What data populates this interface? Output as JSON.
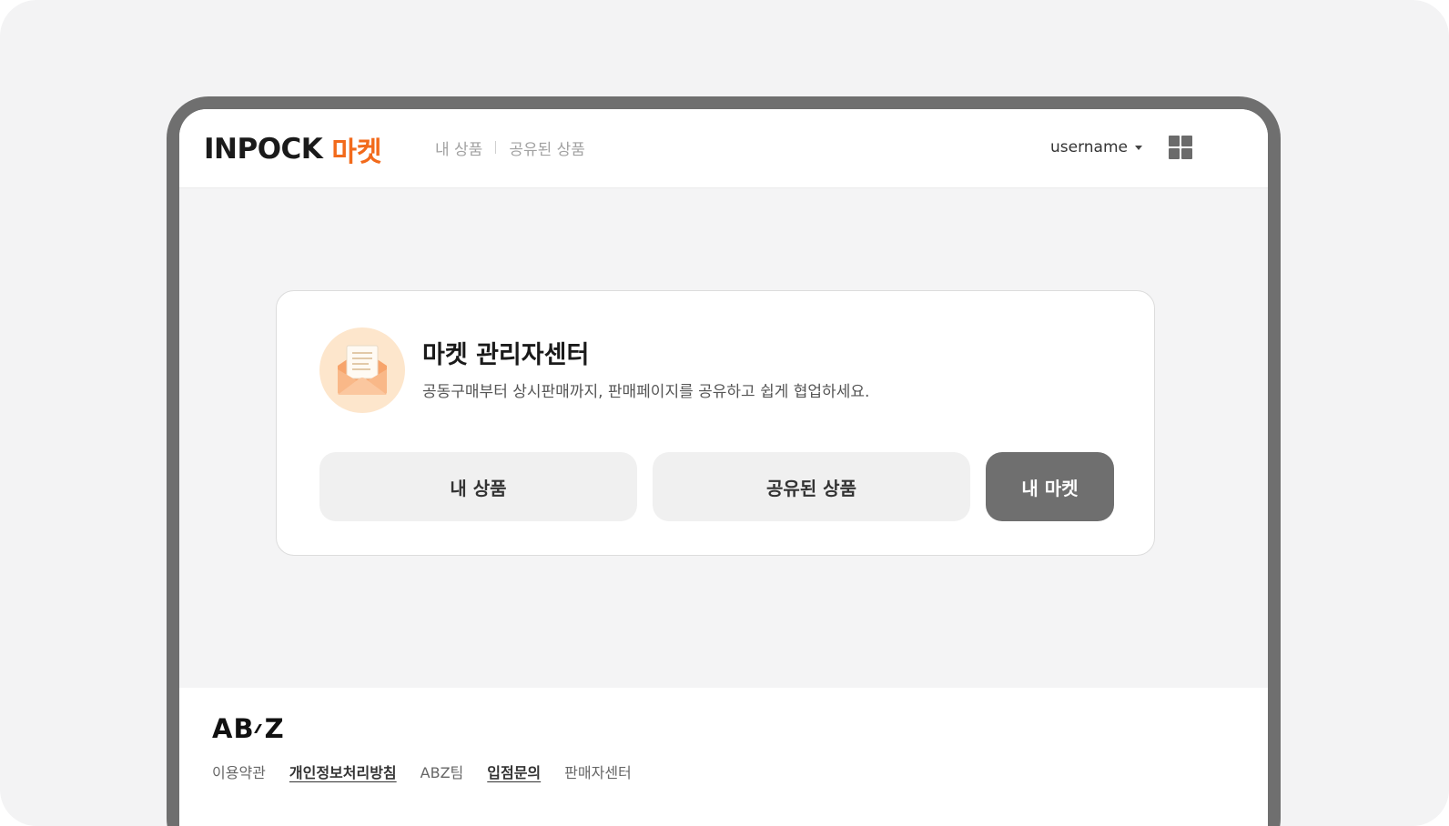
{
  "header": {
    "logo_word": "INPOCK",
    "logo_accent": "마켓",
    "nav": [
      {
        "label": "내 상품"
      },
      {
        "label": "공유된 상품"
      }
    ],
    "username": "username"
  },
  "card": {
    "title": "마켓 관리자센터",
    "description": "공동구매부터 상시판매까지, 판매페이지를 공유하고 쉽게 협업하세요.",
    "buttons": [
      {
        "label": "내 상품"
      },
      {
        "label": "공유된 상품"
      },
      {
        "label": "내 마켓"
      }
    ]
  },
  "footer": {
    "logo_left": "AB",
    "logo_right": "Z",
    "links": [
      {
        "label": "이용약관"
      },
      {
        "label": "개인정보처리방침"
      },
      {
        "label": "ABZ팀"
      },
      {
        "label": "입점문의"
      },
      {
        "label": "판매자센터"
      }
    ]
  },
  "colors": {
    "accent": "#f26a1b",
    "primary_button": "#6f6f6f",
    "secondary_button": "#f0f0f0",
    "icon_background": "#fde6cc"
  },
  "icons": {
    "apps": "grid-icon",
    "card": "envelope-letter-icon",
    "user_menu": "caret-down-icon"
  }
}
